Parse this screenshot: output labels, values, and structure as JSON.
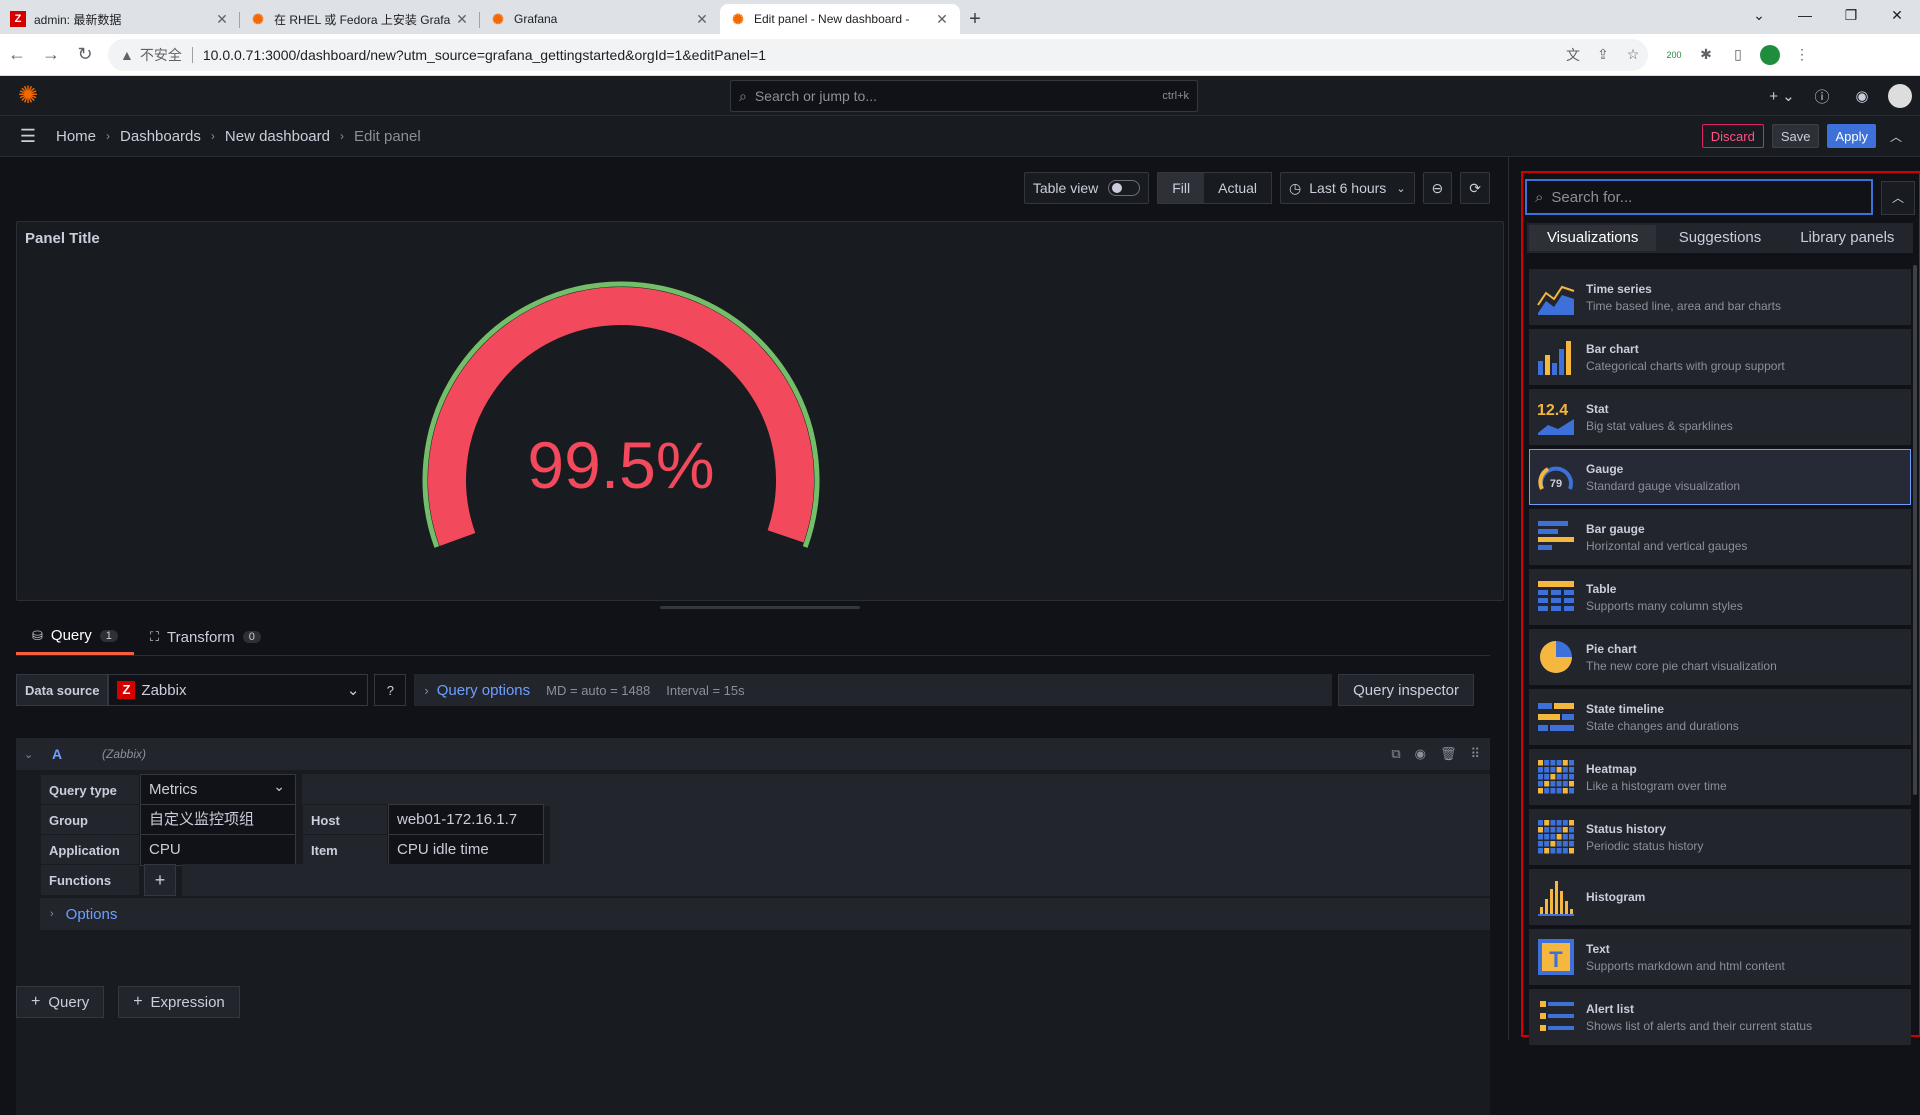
{
  "browser": {
    "tabs": [
      {
        "favicon": "Z",
        "title": "admin: 最新数据"
      },
      {
        "favicon": "grafana",
        "title": "在 RHEL 或 Fedora 上安装 Grafa"
      },
      {
        "favicon": "grafana",
        "title": "Grafana"
      },
      {
        "favicon": "grafana",
        "title": "Edit panel - New dashboard - "
      }
    ],
    "insecure_label": "不安全",
    "url": "10.0.0.71:3000/dashboard/new?utm_source=grafana_gettingstarted&orgId=1&editPanel=1",
    "extension_badge": "200"
  },
  "topnav": {
    "search_placeholder": "Search or jump to...",
    "search_shortcut": "ctrl+k"
  },
  "breadcrumb": [
    "Home",
    "Dashboards",
    "New dashboard",
    "Edit panel"
  ],
  "actions": {
    "discard": "Discard",
    "save": "Save",
    "apply": "Apply"
  },
  "toolbar": {
    "table_view": "Table view",
    "fill": "Fill",
    "actual": "Actual",
    "time_range": "Last 6 hours"
  },
  "panel": {
    "title": "Panel Title",
    "gauge_value": 99.5,
    "gauge_display": "99.5%",
    "gauge_color": "#f2495c",
    "threshold_color": "#73bf69"
  },
  "query_tabs": [
    {
      "label": "Query",
      "count": "1"
    },
    {
      "label": "Transform",
      "count": "0"
    }
  ],
  "datasource": {
    "label": "Data source",
    "value": "Zabbix",
    "query_options": "Query options",
    "md": "MD = auto = 1488",
    "interval": "Interval = 15s",
    "inspector": "Query inspector"
  },
  "query": {
    "letter": "A",
    "ds_name": "(Zabbix)",
    "query_type_label": "Query type",
    "query_type": "Metrics",
    "group_label": "Group",
    "group": "自定义监控项组",
    "host_label": "Host",
    "host": "web01-172.16.1.7",
    "application_label": "Application",
    "application": "CPU",
    "item_label": "Item",
    "item": "CPU idle time",
    "functions_label": "Functions",
    "options_label": "Options"
  },
  "add_buttons": {
    "query": "Query",
    "expression": "Expression"
  },
  "viz_picker": {
    "search_placeholder": "Search for...",
    "tabs": [
      "Visualizations",
      "Suggestions",
      "Library panels"
    ],
    "items": [
      {
        "name": "Time series",
        "desc": "Time based line, area and bar charts",
        "icon": "time-series-icon"
      },
      {
        "name": "Bar chart",
        "desc": "Categorical charts with group support",
        "icon": "bar-chart-icon"
      },
      {
        "name": "Stat",
        "desc": "Big stat values & sparklines",
        "icon": "stat-icon",
        "icon_text": "12.4"
      },
      {
        "name": "Gauge",
        "desc": "Standard gauge visualization",
        "icon": "gauge-icon",
        "icon_text": "79"
      },
      {
        "name": "Bar gauge",
        "desc": "Horizontal and vertical gauges",
        "icon": "bar-gauge-icon"
      },
      {
        "name": "Table",
        "desc": "Supports many column styles",
        "icon": "table-icon"
      },
      {
        "name": "Pie chart",
        "desc": "The new core pie chart visualization",
        "icon": "pie-chart-icon"
      },
      {
        "name": "State timeline",
        "desc": "State changes and durations",
        "icon": "state-timeline-icon"
      },
      {
        "name": "Heatmap",
        "desc": "Like a histogram over time",
        "icon": "heatmap-icon"
      },
      {
        "name": "Status history",
        "desc": "Periodic status history",
        "icon": "status-history-icon"
      },
      {
        "name": "Histogram",
        "desc": "",
        "icon": "histogram-icon"
      },
      {
        "name": "Text",
        "desc": "Supports markdown and html content",
        "icon": "text-icon",
        "icon_text": "T"
      },
      {
        "name": "Alert list",
        "desc": "Shows list of alerts and their current status",
        "icon": "alert-list-icon"
      }
    ],
    "selected": "Gauge"
  }
}
